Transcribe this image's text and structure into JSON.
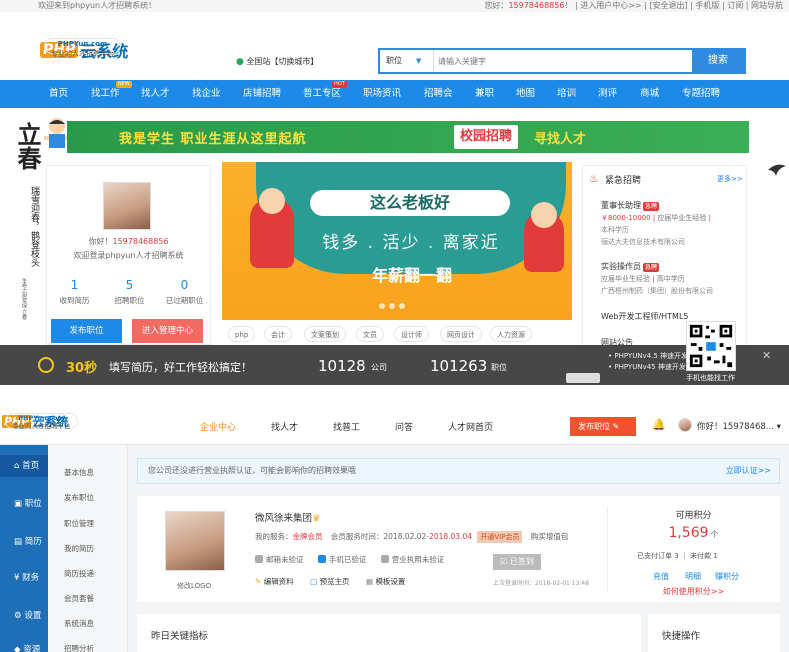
{
  "topbar": {
    "welcome": "欢迎来到phpyun人才招聘系统！",
    "hello": "您好：",
    "phone": "15978468856",
    "links": "！ | 进入用户中心>> | [安全退出] | 手机版 | 订阅 | 网站导航"
  },
  "header": {
    "logo_php": "PHP",
    "logo_yun": "云系统",
    "logo_url": "PHPYun.com",
    "logo_slogan": "专业的人才招聘平台",
    "city": "全国站【切换城市】",
    "search_type": "职位",
    "search_placeholder": "请输入关键字",
    "search_button": "搜索"
  },
  "nav": [
    {
      "label": "首页"
    },
    {
      "label": "找工作",
      "badge": "NEW"
    },
    {
      "label": "找人才"
    },
    {
      "label": "找企业"
    },
    {
      "label": "店铺招聘"
    },
    {
      "label": "普工专区",
      "badge": "HOT"
    },
    {
      "label": "职场资讯"
    },
    {
      "label": "招聘会"
    },
    {
      "label": "兼职"
    },
    {
      "label": "地图"
    },
    {
      "label": "培训"
    },
    {
      "label": "测评"
    },
    {
      "label": "商城"
    },
    {
      "label": "专题招聘"
    }
  ],
  "banner": {
    "left": "我是学生  职业生涯从这里起航",
    "campus1": "校园招聘",
    "campus2": "寻找人才"
  },
  "deco": {
    "big": "立春",
    "poem": "瑞雪迎春，鹊登枝头",
    "small": "生命之树常绿 立春"
  },
  "user": {
    "hello": "你好！",
    "phone": "15978468856",
    "welcome": "欢迎登录phpyun人才招聘系统",
    "stats": [
      {
        "n": "1",
        "k": "收到简历"
      },
      {
        "n": "5",
        "k": "招聘职位"
      },
      {
        "n": "0",
        "k": "已过期职位"
      }
    ],
    "post_button": "发布职位",
    "enter_button": "进入管理中心"
  },
  "slider": {
    "headline": "这么老板好",
    "line2": "钱多 . 活少 . 离家近",
    "line3": "年薪翻一翻"
  },
  "tags": [
    "php",
    "会计",
    "文案策划",
    "文员",
    "设计师",
    "网页设计",
    "人力资源"
  ],
  "urgent": {
    "title": "紧急招聘",
    "more": "更多>>",
    "jobs": [
      {
        "title": "董事长助理",
        "salary": "￥8000-10000",
        "edu": "应届毕业生经验",
        "req": "本科学历",
        "company": "骊达大夫信息技术有限公司"
      },
      {
        "title": "实验操作员",
        "salary": "",
        "edu": "应届毕业生经验",
        "req": "高中学历",
        "company": "广西梧州制药（集团）股份有限公司"
      },
      {
        "title": "Web开发工程师/HTML5",
        "salary": "",
        "edu": "",
        "req": "",
        "company": ""
      }
    ],
    "notice": "网站公告"
  },
  "overlay": {
    "seconds": "30秒",
    "message": "填写简历，好工作轻松搞定！",
    "count1": "10128",
    "unit1": "公司",
    "count2": "101263",
    "unit2": "职位",
    "news1": "PHPYUNv4.5 神速开发新",
    "news2": "PHPYUNv45 神速开发",
    "qr_caption": "手机也能找工作"
  },
  "bottom": {
    "logo_php": "PHP",
    "logo_yun": "云系统",
    "logo_url": "PHPYun.com",
    "logo_slogan": "专业的人才招聘平台",
    "nav": [
      "企业中心",
      "找人才",
      "找普工",
      "问答",
      "人才网首页"
    ],
    "post": "发布职位",
    "user": "你好！15978468...",
    "side": [
      "首页",
      "职位",
      "简历",
      "财务",
      "设置",
      "资源"
    ],
    "sub": [
      "基本信息",
      "发布职位",
      "职位管理",
      "我的简历",
      "简历投递",
      "会员套餐",
      "系统消息",
      "招聘分析"
    ],
    "alert": "您公司还没进行营业执照认证，可能会影响你的招聘效果哦",
    "alert_link": "立即认证>>",
    "company": "微风徐来集团",
    "service_label": "我的服务：",
    "service_level": "金牌会员",
    "service_time_label": "会员服务时间：",
    "service_start": "2018.02.02-",
    "service_end": "2018.03.04",
    "vip": "开通VIP会员",
    "buy": "购买增值包",
    "verify": [
      "邮箱未验证",
      "手机已验证",
      "营业执照未验证"
    ],
    "actions": [
      "编辑资料",
      "预览主页",
      "模板设置"
    ],
    "sign": "已签到",
    "last_login": "上次登录时间：2018-02-01 13:48",
    "avatar_caption": "修改LOGO",
    "points_title": "可用积分",
    "points": "1,569",
    "points_unit": "个",
    "orders": "已支付订单 3 ｜ 未付款 1",
    "order_paid": "3",
    "order_unpaid": "1",
    "point_links": [
      "充值",
      "明细",
      "赚积分"
    ],
    "how": "如何使用积分>>",
    "panel_left": "昨日关键指标",
    "panel_right": "快捷操作"
  }
}
